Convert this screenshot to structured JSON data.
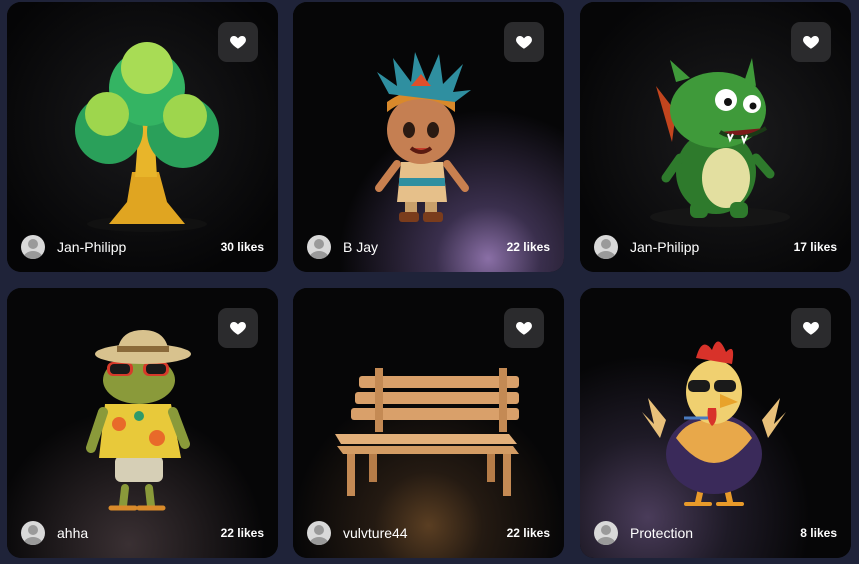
{
  "gallery": {
    "cards": [
      {
        "subject": "cartoon tree",
        "user": "Jan-Philipp",
        "likes": "30 likes"
      },
      {
        "subject": "aztec boy character",
        "user": "B Jay",
        "likes": "22 likes"
      },
      {
        "subject": "green dragon",
        "user": "Jan-Philipp",
        "likes": "17 likes"
      },
      {
        "subject": "frog in hawaiian shirt",
        "user": "ahha",
        "likes": "22 likes"
      },
      {
        "subject": "wooden bench",
        "user": "vulvture44",
        "likes": "22 likes"
      },
      {
        "subject": "rooster with sunglasses",
        "user": "Protection",
        "likes": "8 likes"
      }
    ]
  },
  "icons": {
    "like": "heart-icon",
    "avatar": "user-avatar-icon"
  },
  "colors": {
    "page_background": "#1f2339",
    "card_background": "#050506",
    "like_button": "#2b2b2d",
    "text": "#ffffff"
  }
}
